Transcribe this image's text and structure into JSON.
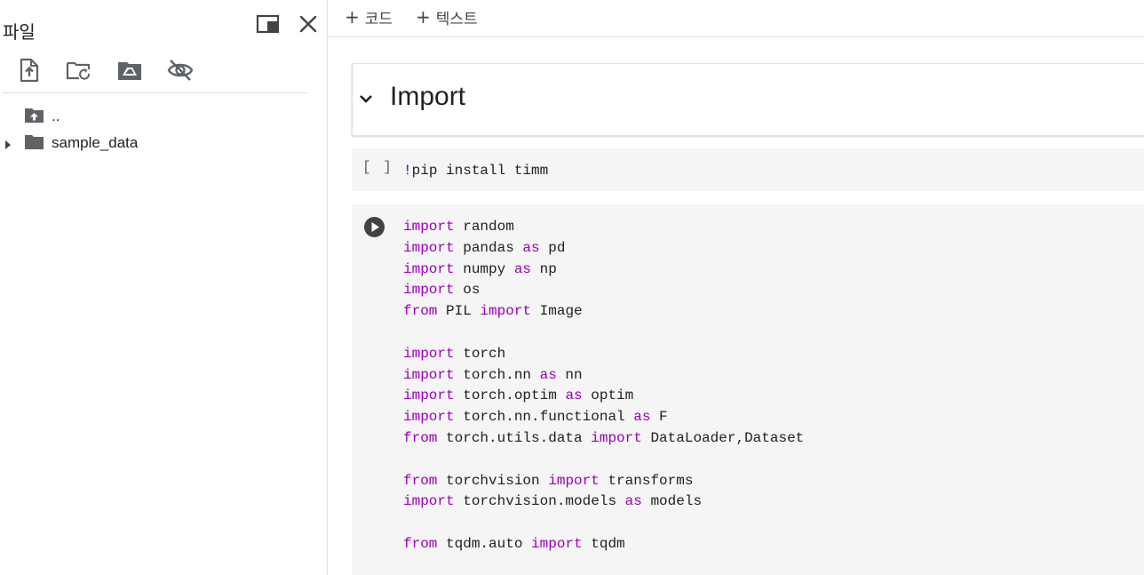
{
  "file_panel": {
    "title": "파일",
    "toolbar": [
      {
        "name": "upload-file-button",
        "icon": "upload-file-icon"
      },
      {
        "name": "refresh-folder-button",
        "icon": "folder-refresh-icon"
      },
      {
        "name": "mount-drive-button",
        "icon": "drive-icon"
      },
      {
        "name": "toggle-hidden-files-button",
        "icon": "eye-off-icon"
      }
    ],
    "tree": [
      {
        "label": "..",
        "icon": "folder-up-icon",
        "expandable": false
      },
      {
        "label": "sample_data",
        "icon": "folder-icon",
        "expandable": true
      }
    ]
  },
  "toolbar": {
    "add_code_label": "코드",
    "add_text_label": "텍스트"
  },
  "section": {
    "title": "Import"
  },
  "cells": [
    {
      "exec_count": "[ ]",
      "lines": [
        [
          {
            "t": "!",
            "c": "bang"
          },
          {
            "t": "pip install timm",
            "c": ""
          }
        ]
      ]
    },
    {
      "exec_count": "",
      "lines": [
        [
          {
            "t": "import",
            "c": "kw"
          },
          {
            "t": " random",
            "c": ""
          }
        ],
        [
          {
            "t": "import",
            "c": "kw"
          },
          {
            "t": " pandas ",
            "c": ""
          },
          {
            "t": "as",
            "c": "kw"
          },
          {
            "t": " pd",
            "c": ""
          }
        ],
        [
          {
            "t": "import",
            "c": "kw"
          },
          {
            "t": " numpy ",
            "c": ""
          },
          {
            "t": "as",
            "c": "kw"
          },
          {
            "t": " np",
            "c": ""
          }
        ],
        [
          {
            "t": "import",
            "c": "kw"
          },
          {
            "t": " os",
            "c": ""
          }
        ],
        [
          {
            "t": "from",
            "c": "kw"
          },
          {
            "t": " PIL ",
            "c": ""
          },
          {
            "t": "import",
            "c": "kw"
          },
          {
            "t": " Image",
            "c": ""
          }
        ],
        [],
        [
          {
            "t": "import",
            "c": "kw"
          },
          {
            "t": " torch",
            "c": ""
          }
        ],
        [
          {
            "t": "import",
            "c": "kw"
          },
          {
            "t": " torch.nn ",
            "c": ""
          },
          {
            "t": "as",
            "c": "kw"
          },
          {
            "t": " nn",
            "c": ""
          }
        ],
        [
          {
            "t": "import",
            "c": "kw"
          },
          {
            "t": " torch.optim ",
            "c": ""
          },
          {
            "t": "as",
            "c": "kw"
          },
          {
            "t": " optim",
            "c": ""
          }
        ],
        [
          {
            "t": "import",
            "c": "kw"
          },
          {
            "t": " torch.nn.functional ",
            "c": ""
          },
          {
            "t": "as",
            "c": "kw"
          },
          {
            "t": " F",
            "c": ""
          }
        ],
        [
          {
            "t": "from",
            "c": "kw"
          },
          {
            "t": " torch.utils.data ",
            "c": ""
          },
          {
            "t": "import",
            "c": "kw"
          },
          {
            "t": " DataLoader,Dataset",
            "c": ""
          }
        ],
        [],
        [
          {
            "t": "from",
            "c": "kw"
          },
          {
            "t": " torchvision ",
            "c": ""
          },
          {
            "t": "import",
            "c": "kw"
          },
          {
            "t": " transforms",
            "c": ""
          }
        ],
        [
          {
            "t": "import",
            "c": "kw"
          },
          {
            "t": " torchvision.models ",
            "c": ""
          },
          {
            "t": "as",
            "c": "kw"
          },
          {
            "t": " models",
            "c": ""
          }
        ],
        [],
        [
          {
            "t": "from",
            "c": "kw"
          },
          {
            "t": " tqdm.auto ",
            "c": ""
          },
          {
            "t": "import",
            "c": "kw"
          },
          {
            "t": " tqdm",
            "c": ""
          }
        ]
      ]
    }
  ],
  "colors": {
    "keyword": "#9b00b8",
    "cell_bg": "#f5f5f5",
    "icon": "#5f6368"
  }
}
